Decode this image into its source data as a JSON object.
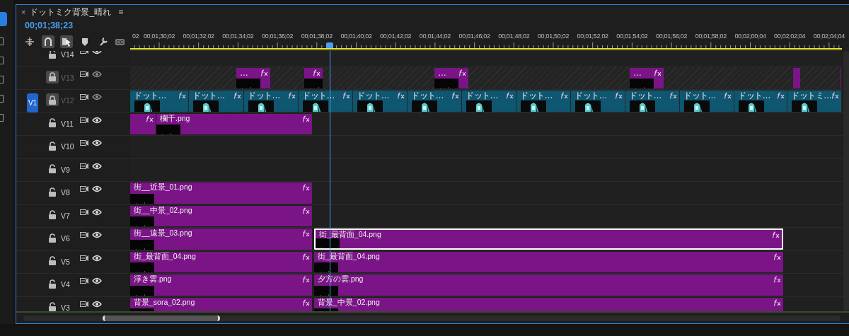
{
  "window": {
    "close": "×",
    "title": "ドットミク背景_晴れ",
    "menu": "≡"
  },
  "timecode": "00;01;38;23",
  "toolbar": [
    {
      "kind": "insert",
      "selected": false
    },
    {
      "kind": "snap",
      "selected": true
    },
    {
      "kind": "linked",
      "selected": true
    },
    {
      "kind": "marker",
      "selected": false
    },
    {
      "kind": "settings",
      "selected": false
    },
    {
      "kind": "captions",
      "label": "CC",
      "selected": false
    }
  ],
  "ruler": {
    "labels": [
      "02",
      "00;01;30;02",
      "00;01;32;02",
      "00;01;34;02",
      "00;01;36;02",
      "00;01;38;02",
      "00;01;40;02",
      "00;01;42;02",
      "00;01;44;02",
      "00;01;46;02",
      "00;01;48;02",
      "00;01;50;02",
      "00;01;52;02",
      "00;01;54;02",
      "00;01;56;02",
      "00;01;58;02",
      "00;02;00;04",
      "00;02;02;04",
      "00;02;04;04"
    ]
  },
  "tracks": [
    {
      "label": "V14",
      "locked": false
    },
    {
      "label": "V13",
      "locked": true,
      "clips": [
        {
          "name": "…",
          "fx": true,
          "selected": false,
          "color": "#7b1587"
        },
        {
          "fx": true,
          "selected": false,
          "color": "#7b1587"
        },
        {
          "name": "…",
          "fx": true,
          "selected": false,
          "color": "#7b1587"
        },
        {
          "name": "…",
          "fx": true,
          "selected": false,
          "color": "#7b1587"
        },
        {
          "fx": false,
          "selected": false,
          "color": "#7b1587"
        },
        {
          "fx": false,
          "selected": false,
          "color": "#7b1587"
        }
      ]
    },
    {
      "label": "V12",
      "locked": true,
      "source_patch": "V1",
      "clips": [
        {
          "name": "ドット…",
          "fx": true,
          "selected": false,
          "color": "#0f5670"
        },
        {
          "name": "ドット…",
          "fx": true,
          "selected": false,
          "color": "#0f5670"
        },
        {
          "name": "ドット…",
          "fx": true,
          "selected": false,
          "color": "#0f5670"
        },
        {
          "name": "ドット…",
          "fx": true,
          "selected": false,
          "color": "#0f5670"
        },
        {
          "name": "ドット…",
          "fx": true,
          "selected": false,
          "color": "#0f5670"
        },
        {
          "name": "ドット…",
          "fx": true,
          "selected": false,
          "color": "#0f5670"
        },
        {
          "name": "ドット…",
          "fx": true,
          "selected": false,
          "color": "#0f5670"
        },
        {
          "name": "ドット…",
          "fx": true,
          "selected": false,
          "color": "#0f5670"
        },
        {
          "name": "ドット…",
          "fx": true,
          "selected": false,
          "color": "#0f5670"
        },
        {
          "name": "ドット…",
          "fx": true,
          "selected": false,
          "color": "#0f5670"
        },
        {
          "name": "ドット…",
          "fx": true,
          "selected": false,
          "color": "#0f5670"
        },
        {
          "name": "ドット…",
          "fx": true,
          "selected": false,
          "color": "#0f5670"
        },
        {
          "name": "ドットミ…",
          "fx": true,
          "selected": false,
          "color": "#0f5670"
        }
      ]
    },
    {
      "label": "V11",
      "locked": false,
      "clips": [
        {
          "fx": true,
          "selected": false,
          "color": "#7b1587"
        },
        {
          "name": "欄干.png",
          "fx": true,
          "selected": false,
          "color": "#7b1587"
        }
      ]
    },
    {
      "label": "V10",
      "locked": false
    },
    {
      "label": "V9",
      "locked": false
    },
    {
      "label": "V8",
      "locked": false,
      "clips": [
        {
          "name": "街__近景_01.png",
          "fx": true,
          "selected": false,
          "color": "#7b1587"
        }
      ]
    },
    {
      "label": "V7",
      "locked": false,
      "clips": [
        {
          "name": "街__中景_02.png",
          "fx": true,
          "selected": false,
          "color": "#7b1587"
        }
      ]
    },
    {
      "label": "V6",
      "locked": false,
      "clips": [
        {
          "name": "街__遠景_03.png",
          "fx": true,
          "selected": false,
          "color": "#7b1587"
        },
        {
          "name": "街_最背面_04.png",
          "fx": true,
          "selected": true,
          "color": "#7b1587"
        }
      ]
    },
    {
      "label": "V5",
      "locked": false,
      "clips": [
        {
          "name": "街_最背面_04.png",
          "fx": true,
          "selected": false,
          "color": "#7b1587"
        },
        {
          "name": "街_最背面_04.png",
          "fx": true,
          "selected": false,
          "color": "#7b1587"
        }
      ]
    },
    {
      "label": "V4",
      "locked": false,
      "clips": [
        {
          "name": "浮き雲.png",
          "fx": true,
          "selected": false,
          "color": "#7b1587"
        },
        {
          "name": "夕方の雲.png",
          "fx": true,
          "selected": false,
          "color": "#7b1587"
        }
      ]
    },
    {
      "label": "V3",
      "locked": false,
      "clips": [
        {
          "name": "背景_sora_02.png",
          "fx": true,
          "selected": false,
          "color": "#7b1587"
        },
        {
          "name": "背景_中景_02.png",
          "fx": true,
          "selected": false,
          "color": "#7b1587"
        }
      ]
    }
  ]
}
